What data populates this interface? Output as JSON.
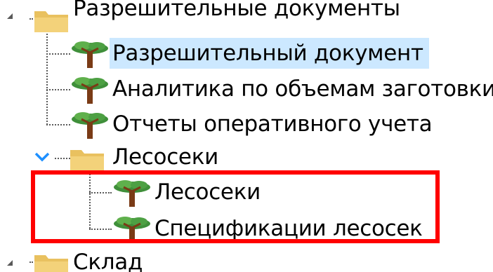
{
  "tree": {
    "items": [
      {
        "label": "Разрешительные документы",
        "icon": "folder-icon",
        "expander": "collapsed-arrow-icon"
      },
      {
        "label": "Разрешительный документ",
        "icon": "tree-icon",
        "selected": true
      },
      {
        "label": "Аналитика по объемам заготовки",
        "icon": "tree-icon"
      },
      {
        "label": "Отчеты оперативного учета",
        "icon": "tree-icon"
      },
      {
        "label": "Лесосеки",
        "icon": "folder-icon",
        "expander": "expanded-chevron-icon"
      },
      {
        "label": "Лесосеки",
        "icon": "tree-icon"
      },
      {
        "label": "Спецификации лесосек",
        "icon": "tree-icon"
      },
      {
        "label": "Склад",
        "icon": "folder-icon",
        "expander": "collapsed-arrow-icon"
      }
    ]
  },
  "colors": {
    "selection": "#cce8ff",
    "highlight_box": "#ff0000",
    "folder": "#f3d27a",
    "tree_crown": "#3f8f3a",
    "tree_trunk": "#7a3b16",
    "chevron": "#1e90ff"
  }
}
